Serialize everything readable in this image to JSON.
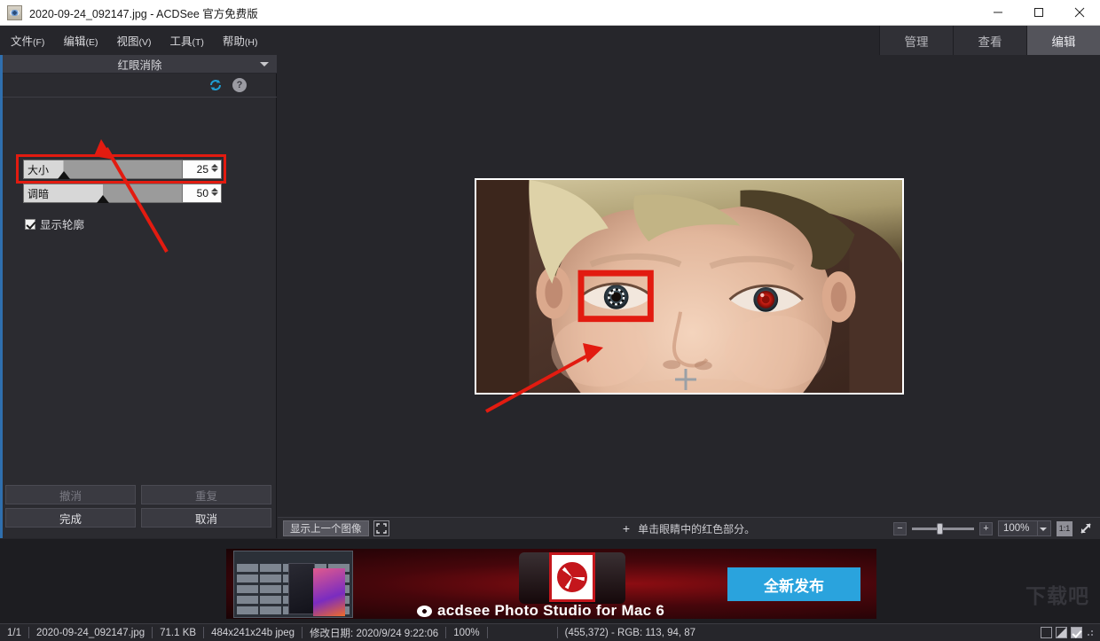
{
  "window": {
    "title": "2020-09-24_092147.jpg - ACDSee 官方免费版",
    "app_icon": "photo-eye-icon",
    "minimize": "minimize-icon",
    "maximize": "maximize-icon",
    "close": "close-icon"
  },
  "menubar": {
    "items": [
      {
        "label": "文件",
        "mnemonic": "(F)"
      },
      {
        "label": "编辑",
        "mnemonic": "(E)"
      },
      {
        "label": "视图",
        "mnemonic": "(V)"
      },
      {
        "label": "工具",
        "mnemonic": "(T)"
      },
      {
        "label": "帮助",
        "mnemonic": "(H)"
      }
    ]
  },
  "mode_tabs": [
    {
      "label": "管理",
      "active": false
    },
    {
      "label": "查看",
      "active": false
    },
    {
      "label": "编辑",
      "active": true
    }
  ],
  "panel": {
    "title": "红眼消除",
    "collapse_icon": "chevron-down-icon",
    "reset_icon": "refresh-icon",
    "help_icon": "help-icon",
    "sliders": [
      {
        "label": "大小",
        "value": "25",
        "percent": 25
      },
      {
        "label": "调暗",
        "value": "50",
        "percent": 50
      }
    ],
    "checkbox": {
      "label": "显示轮廓",
      "checked": true
    },
    "buttons": [
      {
        "label": "撤消",
        "enabled": false
      },
      {
        "label": "重复",
        "enabled": false
      },
      {
        "label": "完成",
        "enabled": true
      },
      {
        "label": "取消",
        "enabled": true
      }
    ]
  },
  "canvas_toolbar": {
    "prev_button": "显示上一个图像",
    "fit_icon": "fit-to-window-icon",
    "hint_plus": "+",
    "hint_text": "单击眼睛中的红色部分。",
    "zoom_out": "−",
    "zoom_in": "+",
    "zoom_value": "100%",
    "zoom_dropdown_icon": "chevron-down-icon",
    "ratio_button": "1:1",
    "expand_icon": "expand-diagonal-icon"
  },
  "ad": {
    "product_text": "acdsee Photo Studio for Mac 6",
    "cta": "全新发布",
    "watermark": "下载吧"
  },
  "statusbar": {
    "page": "1/1",
    "filename": "2020-09-24_092147.jpg",
    "filesize": "71.1 KB",
    "dimensions": "484x241x24b jpeg",
    "modified": "修改日期: 2020/9/24 9:22:06",
    "zoom": "100%",
    "pixel_info": "(455,372) - RGB: 113, 94, 87",
    "icons": [
      "empty-square-icon",
      "half-filled-square-icon",
      "checked-square-icon",
      "resize-grip-icon"
    ]
  },
  "colors": {
    "accent_blue": "#2f6fae",
    "annotation_red": "#e21b10",
    "cta_blue": "#2aa3dd",
    "panel_bg": "#2b2b30",
    "canvas_bg": "#26262b"
  }
}
